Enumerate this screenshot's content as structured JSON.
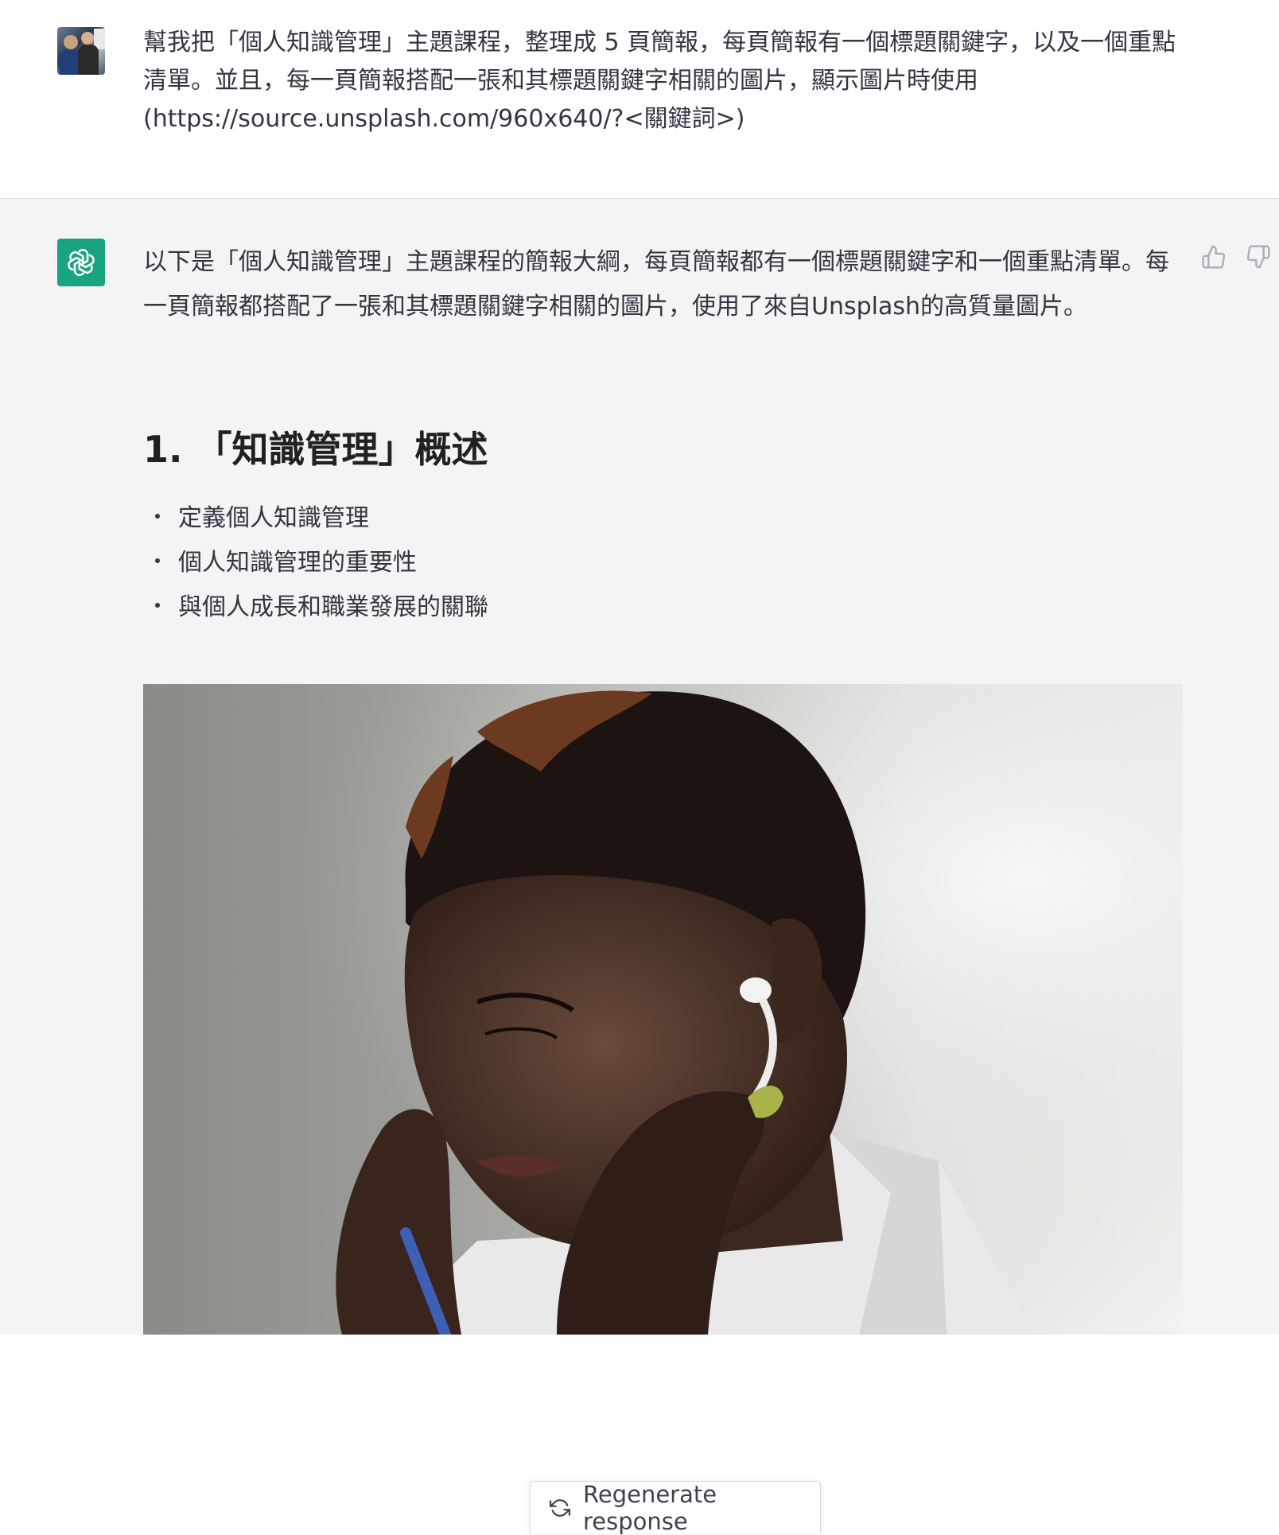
{
  "user": {
    "avatar": "user-photo-avatar",
    "message": "幫我把「個人知識管理」主題課程，整理成 5 頁簡報，每頁簡報有一個標題關鍵字，以及一個重點清單。並且，每一頁簡報搭配一張和其標題關鍵字相關的圖片，顯示圖片時使用(https://source.unsplash.com/960x640/?<關鍵詞>)"
  },
  "assistant": {
    "avatar": "openai-logo-icon",
    "intro": "以下是「個人知識管理」主題課程的簡報大綱，每頁簡報都有一個標題關鍵字和一個重點清單。每一頁簡報都搭配了一張和其標題關鍵字相關的圖片，使用了來自Unsplash的高質量圖片。",
    "section_heading": "1. 「知識管理」概述",
    "bullets": [
      "定義個人知識管理",
      "個人知識管理的重要性",
      "與個人成長和職業發展的關聯"
    ],
    "feedback": {
      "up_icon": "thumbs-up-icon",
      "down_icon": "thumbs-down-icon"
    }
  },
  "regenerate": {
    "label": "Regenerate response",
    "icon": "refresh-icon"
  },
  "colors": {
    "assistant_bg": "#f4f4f4",
    "brand_green": "#19a37f",
    "text": "#343541"
  }
}
